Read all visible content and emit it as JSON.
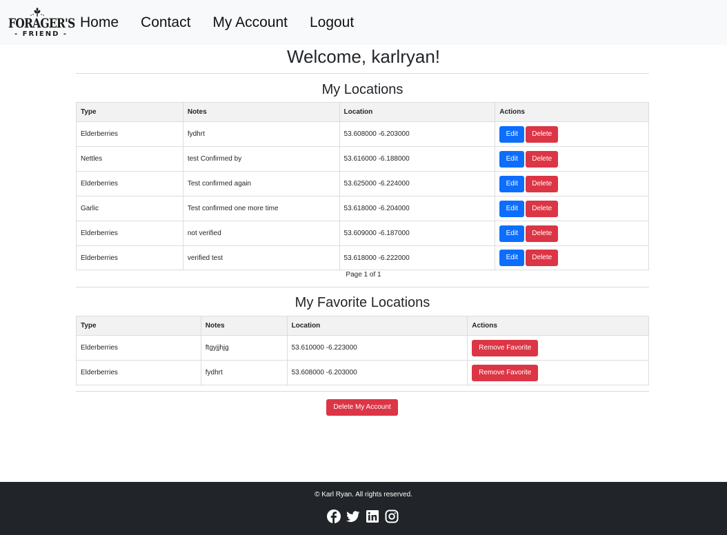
{
  "nav": {
    "logo_line1": "FORAGER'S",
    "logo_line2": "- FRIEND -",
    "links": [
      "Home",
      "Contact",
      "My Account",
      "Logout"
    ]
  },
  "welcome": "Welcome, karlryan!",
  "my_locations": {
    "title": "My Locations",
    "headers": [
      "Type",
      "Notes",
      "Location",
      "Actions"
    ],
    "rows": [
      {
        "type": "Elderberries",
        "notes": "fydhrt",
        "location": "53.608000 -6.203000"
      },
      {
        "type": "Nettles",
        "notes": "test Confirmed by",
        "location": "53.616000 -6.188000"
      },
      {
        "type": "Elderberries",
        "notes": "Test confirmed again",
        "location": "53.625000 -6.224000"
      },
      {
        "type": "Garlic",
        "notes": "Test confirmed one more time",
        "location": "53.618000 -6.204000"
      },
      {
        "type": "Elderberries",
        "notes": "not verified",
        "location": "53.609000 -6.187000"
      },
      {
        "type": "Elderberries",
        "notes": "verified test",
        "location": "53.618000 -6.222000"
      }
    ],
    "edit_label": "Edit",
    "delete_label": "Delete",
    "pager": "Page 1 of 1"
  },
  "favorites": {
    "title": "My Favorite Locations",
    "headers": [
      "Type",
      "Notes",
      "Location",
      "Actions"
    ],
    "rows": [
      {
        "type": "Elderberries",
        "notes": "ftgyjjhjg",
        "location": "53.610000 -6.223000"
      },
      {
        "type": "Elderberries",
        "notes": "fydhrt",
        "location": "53.608000 -6.203000"
      }
    ],
    "remove_label": "Remove Favorite"
  },
  "delete_account_label": "Delete My Account",
  "footer": {
    "copyright": "© Karl Ryan. All rights reserved.",
    "icons": [
      "facebook-icon",
      "twitter-icon",
      "linkedin-icon",
      "instagram-icon"
    ]
  },
  "colors": {
    "primary": "#0d6efd",
    "danger": "#dc3545",
    "navbar_bg": "#f8f9fa",
    "footer_bg": "#212529"
  }
}
